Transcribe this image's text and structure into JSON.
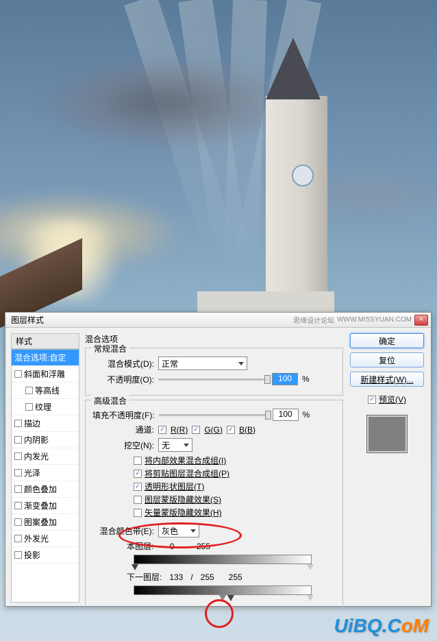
{
  "dialog": {
    "title": "图层样式",
    "forum": "思缘设计论坛",
    "forum_url": "WWW.MISSYUAN.COM",
    "close": "×"
  },
  "left": {
    "header": "样式",
    "items": [
      {
        "label": "混合选项:自定",
        "selected": true,
        "child": false,
        "checkbox": false
      },
      {
        "label": "斜面和浮雕",
        "selected": false,
        "child": false,
        "checkbox": true
      },
      {
        "label": "等高线",
        "selected": false,
        "child": true,
        "checkbox": true
      },
      {
        "label": "纹理",
        "selected": false,
        "child": true,
        "checkbox": true
      },
      {
        "label": "描边",
        "selected": false,
        "child": false,
        "checkbox": true
      },
      {
        "label": "内阴影",
        "selected": false,
        "child": false,
        "checkbox": true
      },
      {
        "label": "内发光",
        "selected": false,
        "child": false,
        "checkbox": true
      },
      {
        "label": "光泽",
        "selected": false,
        "child": false,
        "checkbox": true
      },
      {
        "label": "颜色叠加",
        "selected": false,
        "child": false,
        "checkbox": true
      },
      {
        "label": "渐变叠加",
        "selected": false,
        "child": false,
        "checkbox": true
      },
      {
        "label": "图案叠加",
        "selected": false,
        "child": false,
        "checkbox": true
      },
      {
        "label": "外发光",
        "selected": false,
        "child": false,
        "checkbox": true
      },
      {
        "label": "投影",
        "selected": false,
        "child": false,
        "checkbox": true
      }
    ]
  },
  "center": {
    "section_title": "混合选项",
    "general": {
      "legend": "常规混合",
      "mode_label": "混合模式(D):",
      "mode_value": "正常",
      "opacity_label": "不透明度(O):",
      "opacity_value": "100",
      "percent": "%"
    },
    "advanced": {
      "legend": "高级混合",
      "fill_label": "填充不透明度(F):",
      "fill_value": "100",
      "percent": "%",
      "channel_label": "通道:",
      "ch_r": "R(R)",
      "ch_g": "G(G)",
      "ch_b": "B(B)",
      "knockout_label": "挖空(N):",
      "knockout_value": "无",
      "checks": [
        {
          "label": "将内部效果混合成组(I)",
          "checked": false
        },
        {
          "label": "将剪贴图层混合成组(P)",
          "checked": true
        },
        {
          "label": "透明形状图层(T)",
          "checked": true
        },
        {
          "label": "图层蒙版隐藏效果(S)",
          "checked": false
        },
        {
          "label": "矢量蒙版隐藏效果(H)",
          "checked": false
        }
      ],
      "blendif_label": "混合颜色带(E):",
      "blendif_value": "灰色",
      "this_label": "本图层:",
      "this_low": "0",
      "this_high": "255",
      "under_label": "下一图层:",
      "under_low": "133",
      "under_sep": "/",
      "under_mid": "255",
      "under_high": "255"
    }
  },
  "right": {
    "ok": "确定",
    "cancel": "复位",
    "newstyle": "新建样式(W)...",
    "preview": "预览(V)"
  },
  "watermark": {
    "a": "UiBQ.C",
    "b": "oM"
  }
}
